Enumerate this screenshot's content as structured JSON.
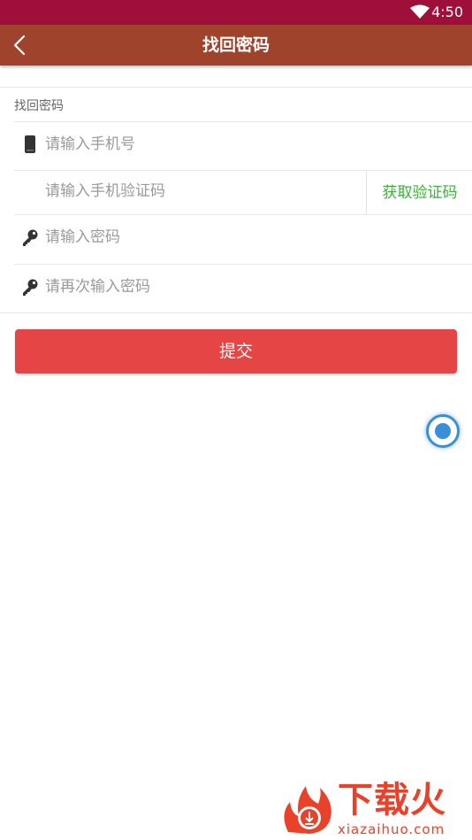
{
  "status_bar": {
    "time": "4:50",
    "wifi_icon": "wifi-icon"
  },
  "nav": {
    "title": "找回密码",
    "back_icon": "chevron-left-icon"
  },
  "form": {
    "section_label": "找回密码",
    "phone_placeholder": "请输入手机号",
    "code_placeholder": "请输入手机验证码",
    "get_code_label": "获取验证码",
    "password_placeholder": "请输入密码",
    "confirm_password_placeholder": "请再次输入密码",
    "phone_icon": "phone-icon",
    "key_icon": "key-icon"
  },
  "submit_label": "提交",
  "watermark": {
    "text": "下载火",
    "domain": "xiazaihuo.com"
  },
  "colors": {
    "status_bar": "#9e0f3a",
    "nav_bar": "#a0432c",
    "submit": "#e64545",
    "get_code": "#3ab03a",
    "float_button": "#3a8fd8",
    "watermark": "#e8432a"
  }
}
